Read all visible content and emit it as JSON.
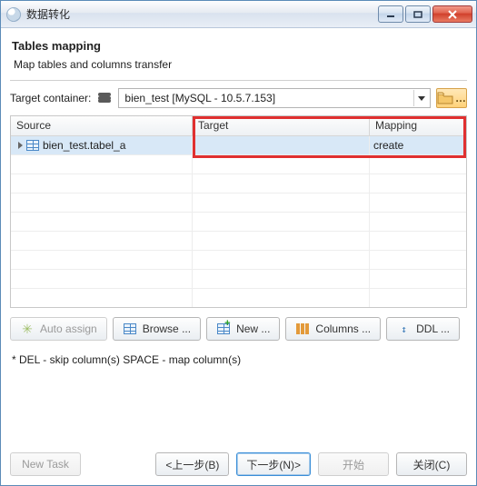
{
  "window": {
    "title": "数据转化"
  },
  "page": {
    "heading": "Tables mapping",
    "subheading": "Map tables and columns transfer"
  },
  "target": {
    "label": "Target container:",
    "selected": "bien_test  [MySQL - 10.5.7.153]"
  },
  "table": {
    "columns": {
      "source": "Source",
      "target": "Target",
      "mapping": "Mapping"
    },
    "rows": [
      {
        "source": "bien_test.tabel_a",
        "target": "",
        "mapping": "create"
      }
    ]
  },
  "actions": {
    "auto_assign": "Auto assign",
    "browse": "Browse ...",
    "new": "New ...",
    "columns": "Columns ...",
    "ddl": "DDL ..."
  },
  "hint": "* DEL - skip column(s)  SPACE - map column(s)",
  "footer": {
    "new_task": "New Task",
    "back": "<上一步(B)",
    "next": "下一步(N)>",
    "start": "开始",
    "close": "关闭(C)"
  }
}
